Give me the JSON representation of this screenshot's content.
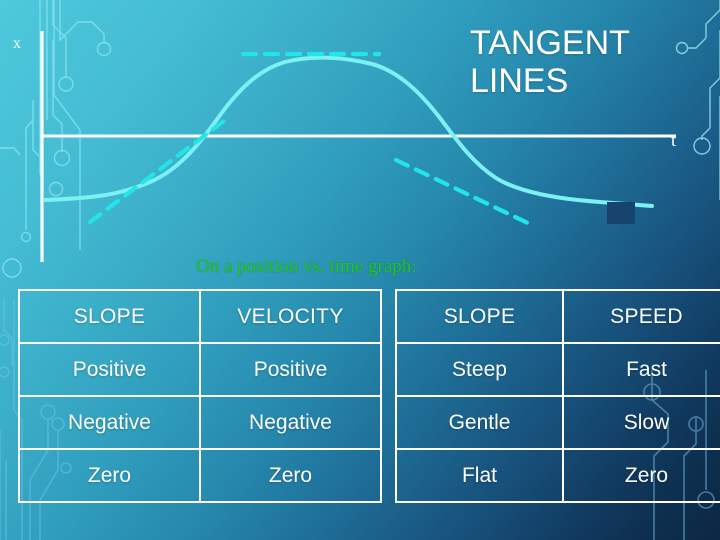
{
  "slide": {
    "title": "TANGENT LINES",
    "title_lines": [
      "TANGENT",
      "LINES"
    ],
    "caption": "On a position vs. time graph:"
  },
  "graph": {
    "y_axis_label": "x",
    "x_axis_label": "t",
    "curve_color": "#7ef0f2",
    "tangent_color": "#22e6e6",
    "axis_color": "#ffffff",
    "tangents": [
      {
        "name": "positive-slope-tangent",
        "slope": "positive"
      },
      {
        "name": "zero-slope-tangent",
        "slope": "zero"
      },
      {
        "name": "negative-slope-tangent",
        "slope": "negative"
      }
    ]
  },
  "colors": {
    "background_top_left": "#4ec8db",
    "background_bottom_right": "#0c2743",
    "caption_green": "#22c522",
    "title_white": "#ffffff",
    "swatch_navy": "#16446e"
  },
  "tables": [
    {
      "name": "slope-velocity-table",
      "headers": [
        "SLOPE",
        "VELOCITY"
      ],
      "rows": [
        [
          "Positive",
          "Positive"
        ],
        [
          "Negative",
          "Negative"
        ],
        [
          "Zero",
          "Zero"
        ]
      ]
    },
    {
      "name": "slope-speed-table",
      "headers": [
        "SLOPE",
        "SPEED"
      ],
      "rows": [
        [
          "Steep",
          "Fast"
        ],
        [
          "Gentle",
          "Slow"
        ],
        [
          "Flat",
          "Zero"
        ]
      ]
    }
  ]
}
